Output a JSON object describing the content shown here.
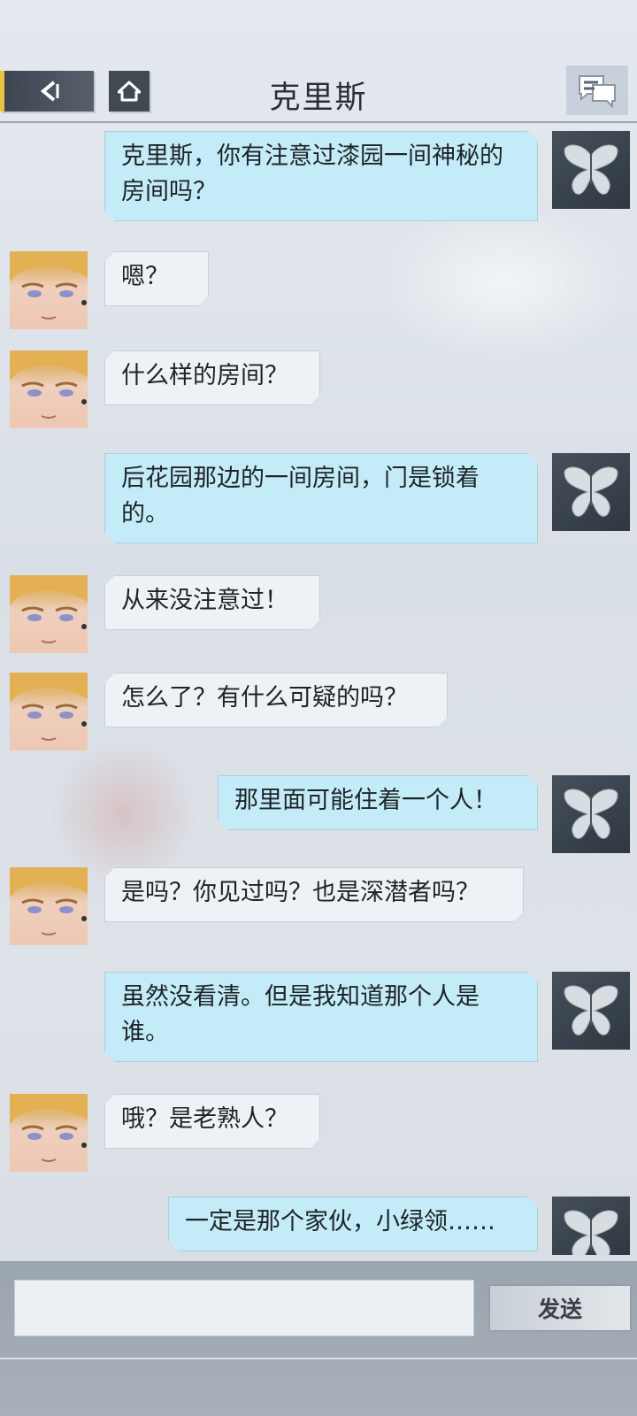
{
  "header": {
    "title": "克里斯",
    "back_icon": "back-arrow-icon",
    "home_icon": "home-icon",
    "chat_icon": "chat-bubbles-icon",
    "accent_color": "#e9c23f"
  },
  "messages": [
    {
      "sender": "me",
      "text": "克里斯，你有注意过漆园一间神秘的房间吗？"
    },
    {
      "sender": "克里斯",
      "text": "嗯？"
    },
    {
      "sender": "克里斯",
      "text": "什么样的房间？"
    },
    {
      "sender": "me",
      "text": "后花园那边的一间房间，门是锁着的。"
    },
    {
      "sender": "克里斯",
      "text": "从来没注意过！"
    },
    {
      "sender": "克里斯",
      "text": "怎么了？有什么可疑的吗？"
    },
    {
      "sender": "me",
      "text": "那里面可能住着一个人！"
    },
    {
      "sender": "克里斯",
      "text": "是吗？你见过吗？也是深潜者吗？"
    },
    {
      "sender": "me",
      "text": "虽然没看清。但是我知道那个人是谁。"
    },
    {
      "sender": "克里斯",
      "text": "哦？是老熟人？"
    },
    {
      "sender": "me",
      "text": "一定是那个家伙，小绿领……"
    }
  ],
  "input": {
    "value": "",
    "placeholder": ""
  },
  "send_button": {
    "label": "发送"
  },
  "colors": {
    "my_bubble": "#c4ecf8",
    "their_bubble": "#eef1f5"
  }
}
